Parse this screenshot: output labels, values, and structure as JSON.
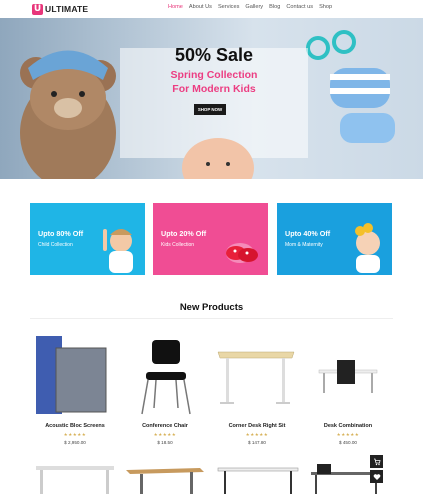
{
  "header": {
    "logo_mark": "U",
    "logo_text": "ULTIMATE",
    "nav": [
      "Home",
      "About Us",
      "Services",
      "Gallery",
      "Blog",
      "Contact us",
      "Shop"
    ]
  },
  "hero": {
    "title": "50% Sale",
    "subtitle_line1": "Spring Collection",
    "subtitle_line2": "For Modern Kids",
    "button": "SHOP NOW"
  },
  "promos": [
    {
      "title": "Upto 80% Off",
      "subtitle": "Child Collection",
      "color": "#1fb5e6"
    },
    {
      "title": "Upto 20% Off",
      "subtitle": "Kids Collection",
      "color": "#f04d94"
    },
    {
      "title": "Upto 40% Off",
      "subtitle": "Mom & Maternity",
      "color": "#1aa0de"
    }
  ],
  "products_section": {
    "title": "New Products",
    "items": [
      {
        "name": "Acoustic Bloc Screens",
        "price": "$ 2,950.00",
        "stars": "★★★★★"
      },
      {
        "name": "Conference Chair",
        "price": "$ 18.50",
        "stars": "★★★★★"
      },
      {
        "name": "Corner Desk Right Sit",
        "price": "$ 147.80",
        "stars": "★★★★★"
      },
      {
        "name": "Desk Combination",
        "price": "$ 450.00",
        "stars": "★★★★★"
      }
    ]
  },
  "side_buttons": {
    "cart_icon": "cart-icon",
    "heart_icon": "heart-icon"
  },
  "colors": {
    "accent": "#e8357a",
    "pink": "#f04d94",
    "blue": "#1fb5e6"
  }
}
